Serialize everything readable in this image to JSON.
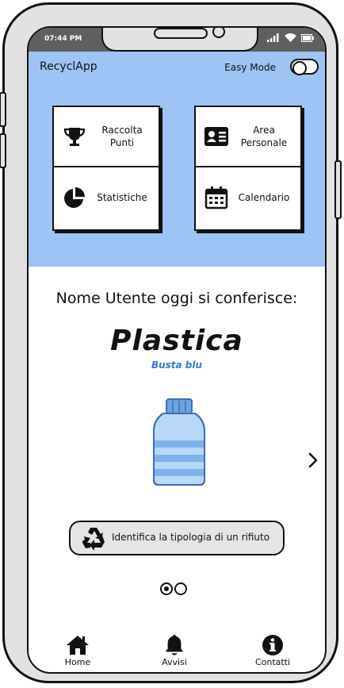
{
  "status_bar": {
    "time": "07:44 PM"
  },
  "header": {
    "app_title": "RecyclApp",
    "easy_mode_label": "Easy Mode",
    "easy_mode_on": false
  },
  "menu": {
    "raccolta_punti": "Raccolta Punti",
    "area_personale": "Area Personale",
    "statistiche": "Statistiche",
    "calendario": "Calendario"
  },
  "main": {
    "greeting": "Nome Utente oggi si conferisce:",
    "material": "Plastica",
    "bag": "Busta blu",
    "identify_label": "Identifica la tipologia di un rifiuto",
    "carousel_pages": 2,
    "carousel_active": 1
  },
  "navbar": {
    "home": "Home",
    "avvisi": "Avvisi",
    "contatti": "Contatti"
  },
  "colors": {
    "header_bg": "#9ec4f5",
    "accent": "#3b78d0",
    "status_bar": "#5f5f5f"
  }
}
